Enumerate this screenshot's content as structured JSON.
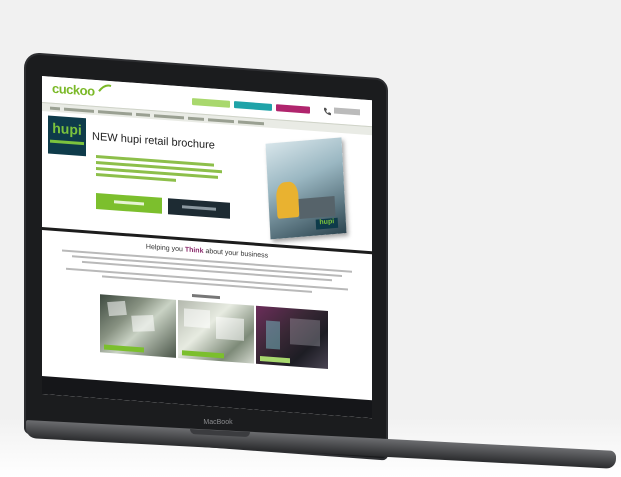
{
  "laptop": {
    "brand": "MacBook"
  },
  "site": {
    "logo_text": "cuckoo",
    "hero": {
      "badge_text": "hupi",
      "title": "NEW hupi retail brochure"
    },
    "content": {
      "title_prefix": "Helping you",
      "title_highlight": "Think",
      "title_suffix": "about your business"
    }
  },
  "colors": {
    "brand_green": "#7bb928",
    "accent_teal": "#1fa3a8",
    "accent_magenta": "#b0256d",
    "dark_navy": "#1d2b33"
  }
}
